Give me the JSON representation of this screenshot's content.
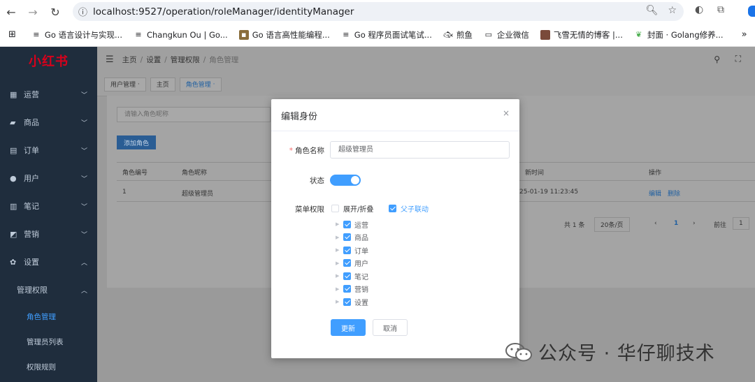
{
  "browser": {
    "url": "localhost:9527/operation/roleManager/identityManager",
    "bookmarks": [
      {
        "label": "Go 语言设计与实现...",
        "icon": "doc-icon"
      },
      {
        "label": "Changkun Ou | Go...",
        "icon": "doc-icon"
      },
      {
        "label": "Go 语言高性能编程...",
        "icon": "image-icon"
      },
      {
        "label": "Go 程序员面试笔试...",
        "icon": "doc-icon"
      },
      {
        "label": "煎鱼",
        "icon": "fish-icon"
      },
      {
        "label": "企业微信",
        "icon": "folder-icon"
      },
      {
        "label": "飞雪无情的博客 |...",
        "icon": "avatar-icon"
      },
      {
        "label": "封面 · Golang修养...",
        "icon": "leaf-icon"
      }
    ],
    "more": "»"
  },
  "sidebar": {
    "logo": "小红书",
    "items": [
      {
        "label": "运营",
        "icon": "grid-icon",
        "arrow": "﹀"
      },
      {
        "label": "商品",
        "icon": "bag-icon",
        "arrow": "﹀"
      },
      {
        "label": "订单",
        "icon": "clipboard-icon",
        "arrow": "﹀"
      },
      {
        "label": "用户",
        "icon": "user-icon",
        "arrow": "﹀"
      },
      {
        "label": "笔记",
        "icon": "chart-icon",
        "arrow": "﹀"
      },
      {
        "label": "营销",
        "icon": "trend-icon",
        "arrow": "﹀"
      },
      {
        "label": "设置",
        "icon": "gear-icon",
        "arrow": "︿"
      }
    ],
    "group": {
      "label": "管理权限",
      "arrow": "︿"
    },
    "sub_items": [
      "角色管理",
      "管理员列表",
      "权限规则"
    ]
  },
  "navbar": {
    "breadcrumb": [
      "主页",
      "设置",
      "管理权限",
      "角色管理"
    ]
  },
  "tags": [
    "用户管理",
    "主页",
    "角色管理"
  ],
  "page": {
    "search_placeholder": "请输入角色昵称",
    "add_button": "添加角色",
    "columns": {
      "id": "角色编号",
      "name": "角色昵称",
      "time": "新时间",
      "ops": "操作"
    },
    "row": {
      "id": "1",
      "name": "超级管理员",
      "time": "25-01-19 11:23:45",
      "edit": "编辑",
      "delete": "删除"
    },
    "pager": {
      "total": "共 1 条",
      "size": "20条/页",
      "prev": "‹",
      "page": "1",
      "next": "›",
      "goto": "前往",
      "goto_value": "1"
    }
  },
  "modal": {
    "title": "编辑身份",
    "close": "×",
    "name_label": "角色名称",
    "required_mark": "*",
    "name_value": "超级管理员",
    "status_label": "状态",
    "status_on": true,
    "perm_label": "菜单权限",
    "expand_label": "展开/折叠",
    "linkage_label": "父子联动",
    "tree": [
      "运营",
      "商品",
      "订单",
      "用户",
      "笔记",
      "营销",
      "设置"
    ],
    "save": "更新",
    "cancel": "取消"
  },
  "watermark": "公众号 · 华仔聊技术",
  "colors": {
    "primary": "#409eff",
    "sidebar": "#1f2d3d",
    "logo": "#d9001b"
  }
}
